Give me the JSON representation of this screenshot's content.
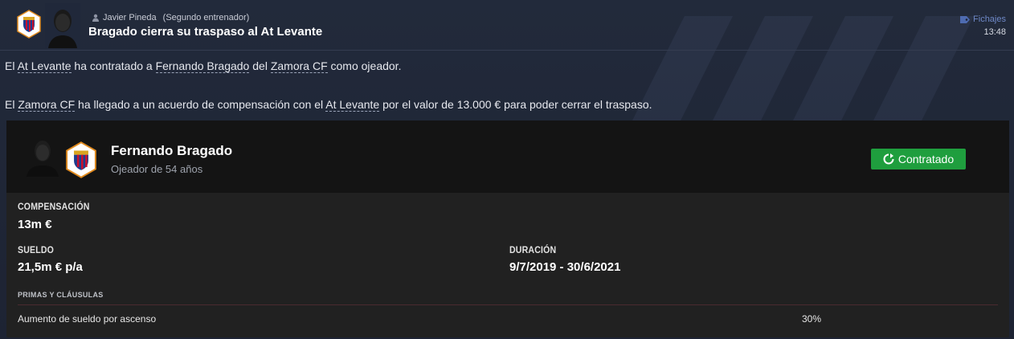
{
  "header": {
    "sender_name": "Javier Pineda",
    "sender_role": "(Segundo entrenador)",
    "subject": "Bragado cierra su traspaso al At Levante",
    "category": "Fichajes",
    "time": "13:48"
  },
  "message": {
    "p1": {
      "t1": "El ",
      "club_a": "At Levante",
      "t2": " ha contratado a ",
      "person": "Fernando Bragado",
      "t3": " del ",
      "club_b": "Zamora CF",
      "t4": " como ojeador."
    },
    "p2": {
      "t1": "El ",
      "club_b": "Zamora CF",
      "t2": " ha llegado a un acuerdo de compensación con el ",
      "club_a": "At Levante",
      "t3": " por el valor de 13.000 € para poder cerrar el traspaso."
    }
  },
  "card": {
    "name": "Fernando Bragado",
    "subtitle": "Ojeador de 54 años",
    "status_label": "Contratado",
    "compensation_label": "COMPENSACIÓN",
    "compensation_value": "13m €",
    "salary_label": "SUELDO",
    "salary_value": "21,5m € p/a",
    "duration_label": "DURACIÓN",
    "duration_value": "9/7/2019 - 30/6/2021",
    "clauses_label": "PRIMAS Y CLÁUSULAS",
    "clauses": [
      {
        "name": "Aumento de sueldo por ascenso",
        "value": "30%"
      }
    ]
  },
  "colors": {
    "status_green": "#1f9e3e",
    "category_blue": "#6f89c8"
  },
  "icons": {
    "person": "person-icon",
    "category": "tag-icon",
    "status": "refresh-icon"
  }
}
